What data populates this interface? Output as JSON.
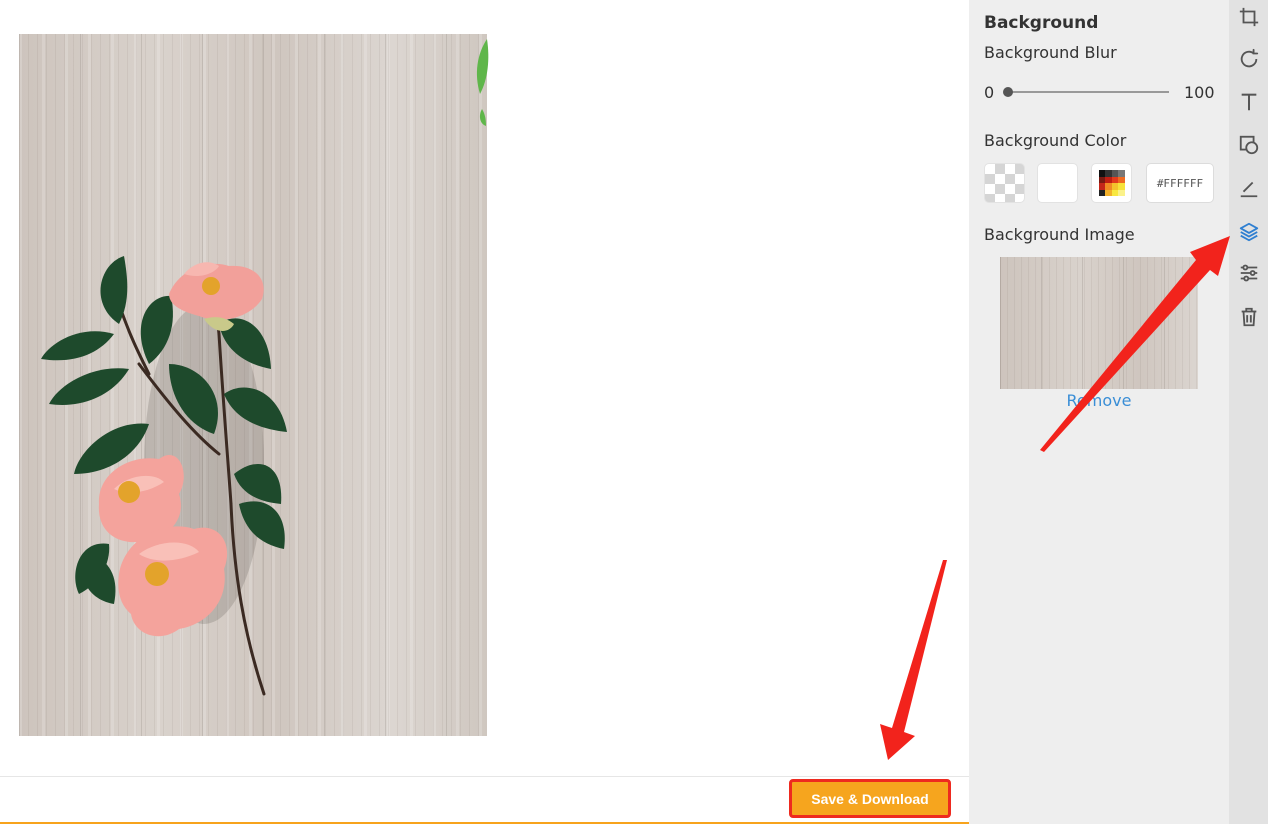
{
  "panel": {
    "title": "Background",
    "blur": {
      "label": "Background Blur",
      "min": "0",
      "max": "100",
      "value": 0
    },
    "color": {
      "label": "Background Color",
      "swatches": [
        "transparent",
        "white",
        "color-picker"
      ],
      "hex_value": "#FFFFFF"
    },
    "image": {
      "label": "Background Image",
      "remove_label": "Remove"
    }
  },
  "toolbar": {
    "icons": [
      "crop-icon",
      "rotate-icon",
      "text-icon",
      "shape-icon",
      "draw-icon",
      "layers-icon",
      "adjust-icon",
      "trash-icon"
    ],
    "active": "layers-icon"
  },
  "footer": {
    "save_label": "Save & Download"
  },
  "colors": {
    "accent": "#f6a51e",
    "highlight_border": "#ee2a1f",
    "link": "#3a8ed6",
    "active_icon": "#2f7fd1",
    "annotation_arrow": "#f2231c"
  }
}
